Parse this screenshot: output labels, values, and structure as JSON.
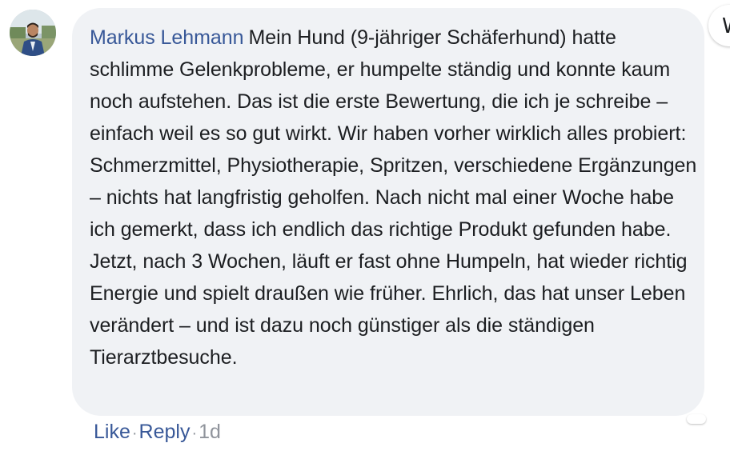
{
  "comment": {
    "author": "Markus Lehmann",
    "body": "Mein Hund (9-jähriger Schäferhund) hatte schlimme Gelenkprobleme, er humpelte ständig und konnte kaum noch aufstehen. Das ist die erste Bewertung, die ich je schreibe – einfach weil es so gut wirkt. Wir haben vorher wirklich alles probiert: Schmerzmittel, Physiotherapie, Spritzen, verschiedene Ergänzungen – nichts hat langfristig geholfen. Nach nicht mal einer Woche habe ich gemerkt, dass ich endlich das richtige Produkt gefunden habe. Jetzt, nach 3 Wochen, läuft er fast ohne Humpeln, hat wieder richtig Energie und spielt draußen wie früher. Ehrlich, das hat unser Leben verändert – und ist dazu noch günstiger als die ständigen Tierarztbesuche."
  },
  "actions": {
    "like": "Like",
    "reply": "Reply",
    "separator": "·",
    "time": "1d"
  },
  "corner_widget": {
    "glyph": "W",
    "icon": "partial-profile-icon"
  },
  "colors": {
    "author_link": "#385898",
    "bubble_bg": "#f0f2f5",
    "text": "#1c1e21",
    "meta": "#90949c"
  }
}
